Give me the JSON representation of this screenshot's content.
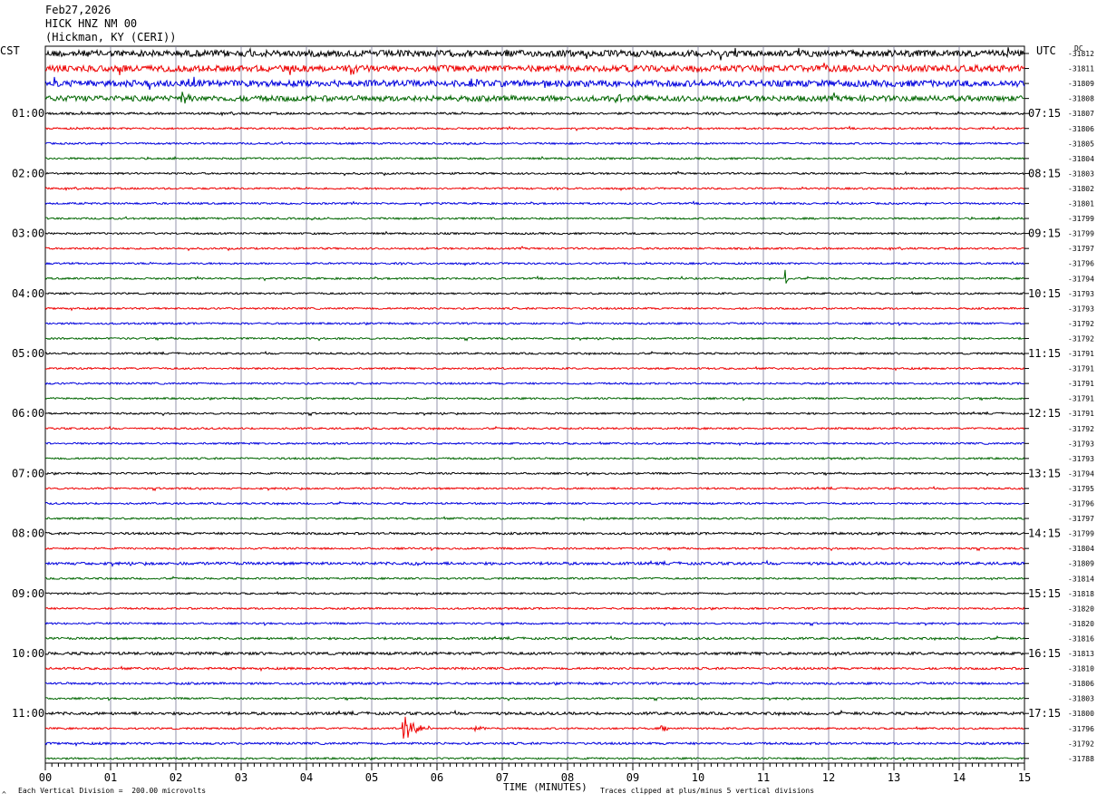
{
  "header": {
    "date": "Feb27,2026",
    "station": "HICK HNZ NM 00",
    "location": "(Hickman, KY (CERI))"
  },
  "left_axis_label": "CST",
  "right_axis_label": "UTC",
  "dc_label": "DC",
  "footer": {
    "scale_note": "Each Vertical Division =  200.00 microvolts",
    "clip_note": "Traces clipped at plus/minus 5 vertical divisions",
    "corner_mark": "^"
  },
  "chart_data": {
    "type": "line",
    "xlabel": "TIME (MINUTES)",
    "xlim": [
      0,
      15
    ],
    "x_ticks": [
      "00",
      "01",
      "02",
      "03",
      "04",
      "05",
      "06",
      "07",
      "08",
      "09",
      "10",
      "11",
      "12",
      "13",
      "14",
      "15"
    ],
    "trace_colors": [
      "#000000",
      "#ee0000",
      "#0000dd",
      "#006600"
    ],
    "rows_count": 48,
    "hour_labels_left": [
      {
        "row": 4,
        "text": "01:00"
      },
      {
        "row": 8,
        "text": "02:00"
      },
      {
        "row": 12,
        "text": "03:00"
      },
      {
        "row": 16,
        "text": "04:00"
      },
      {
        "row": 20,
        "text": "05:00"
      },
      {
        "row": 24,
        "text": "06:00"
      },
      {
        "row": 28,
        "text": "07:00"
      },
      {
        "row": 32,
        "text": "08:00"
      },
      {
        "row": 36,
        "text": "09:00"
      },
      {
        "row": 40,
        "text": "10:00"
      },
      {
        "row": 44,
        "text": "11:00"
      }
    ],
    "hour_labels_right": [
      {
        "row": 4,
        "text": "07:15"
      },
      {
        "row": 8,
        "text": "08:15"
      },
      {
        "row": 12,
        "text": "09:15"
      },
      {
        "row": 16,
        "text": "10:15"
      },
      {
        "row": 20,
        "text": "11:15"
      },
      {
        "row": 24,
        "text": "12:15"
      },
      {
        "row": 28,
        "text": "13:15"
      },
      {
        "row": 32,
        "text": "14:15"
      },
      {
        "row": 36,
        "text": "15:15"
      },
      {
        "row": 40,
        "text": "16:15"
      },
      {
        "row": 44,
        "text": "17:15"
      }
    ],
    "dc_offsets": [
      "-31812",
      "-31811",
      "-31809",
      "-31808",
      "-31807",
      "-31806",
      "-31805",
      "-31804",
      "-31803",
      "-31802",
      "-31801",
      "-31799",
      "-31799",
      "-31797",
      "-31796",
      "-31794",
      "-31793",
      "-31793",
      "-31792",
      "-31792",
      "-31791",
      "-31791",
      "-31791",
      "-31791",
      "-31791",
      "-31792",
      "-31793",
      "-31793",
      "-31794",
      "-31795",
      "-31796",
      "-31797",
      "-31799",
      "-31804",
      "-31809",
      "-31814",
      "-31818",
      "-31820",
      "-31820",
      "-31816",
      "-31813",
      "-31810",
      "-31806",
      "-31803",
      "-31800",
      "-31796",
      "-31792",
      "-31788"
    ],
    "row_noise": [
      3.5,
      3.5,
      3.5,
      3,
      1.2,
      1,
      1,
      1,
      1,
      1,
      1,
      1,
      1,
      1,
      1,
      1,
      1,
      1,
      1,
      1,
      1,
      1,
      1,
      1,
      1,
      1,
      1,
      1,
      1,
      1,
      1,
      1,
      1.2,
      1,
      1.5,
      1,
      1,
      1,
      1,
      1.2,
      1.5,
      1.2,
      1.2,
      1,
      1.5,
      1,
      1.2,
      1
    ],
    "events": [
      {
        "row": 15,
        "minute": 11.35,
        "amplitude": 10,
        "duration": 0.05
      },
      {
        "row": 34,
        "minute": 5.65,
        "amplitude": 3,
        "duration": 0.3
      },
      {
        "row": 45,
        "minute": 5.5,
        "amplitude": 14,
        "duration": 0.45
      },
      {
        "row": 45,
        "minute": 6.6,
        "amplitude": 3,
        "duration": 0.2
      },
      {
        "row": 45,
        "minute": 9.45,
        "amplitude": 4,
        "duration": 0.15
      },
      {
        "row": 2,
        "minute": 6.5,
        "amplitude": 6,
        "duration": 0.2
      },
      {
        "row": 3,
        "minute": 2.1,
        "amplitude": 6,
        "duration": 0.3
      },
      {
        "row": 3,
        "minute": 8.7,
        "amplitude": 5,
        "duration": 0.3
      }
    ]
  }
}
